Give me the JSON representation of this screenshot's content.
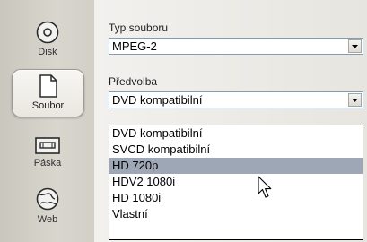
{
  "sidebar": {
    "items": [
      {
        "label": "Disk",
        "icon": "disc-icon",
        "active": false
      },
      {
        "label": "Soubor",
        "icon": "file-icon",
        "active": true
      },
      {
        "label": "Páska",
        "icon": "tape-icon",
        "active": false
      },
      {
        "label": "Web",
        "icon": "globe-icon",
        "active": false
      }
    ]
  },
  "form": {
    "file_type_label": "Typ souboru",
    "file_type_value": "MPEG-2",
    "preset_label": "Předvolba",
    "preset_value": "DVD kompatibilní"
  },
  "dropdown": {
    "options": [
      "DVD kompatibilní",
      "SVCD kompatibilní",
      "HD 720p",
      "HDV2 1080i",
      "HD 1080i",
      "Vlastní"
    ],
    "highlighted": "HD 720p"
  },
  "colors": {
    "highlight": "#9ea7b6",
    "field_border": "#7f9db9"
  }
}
